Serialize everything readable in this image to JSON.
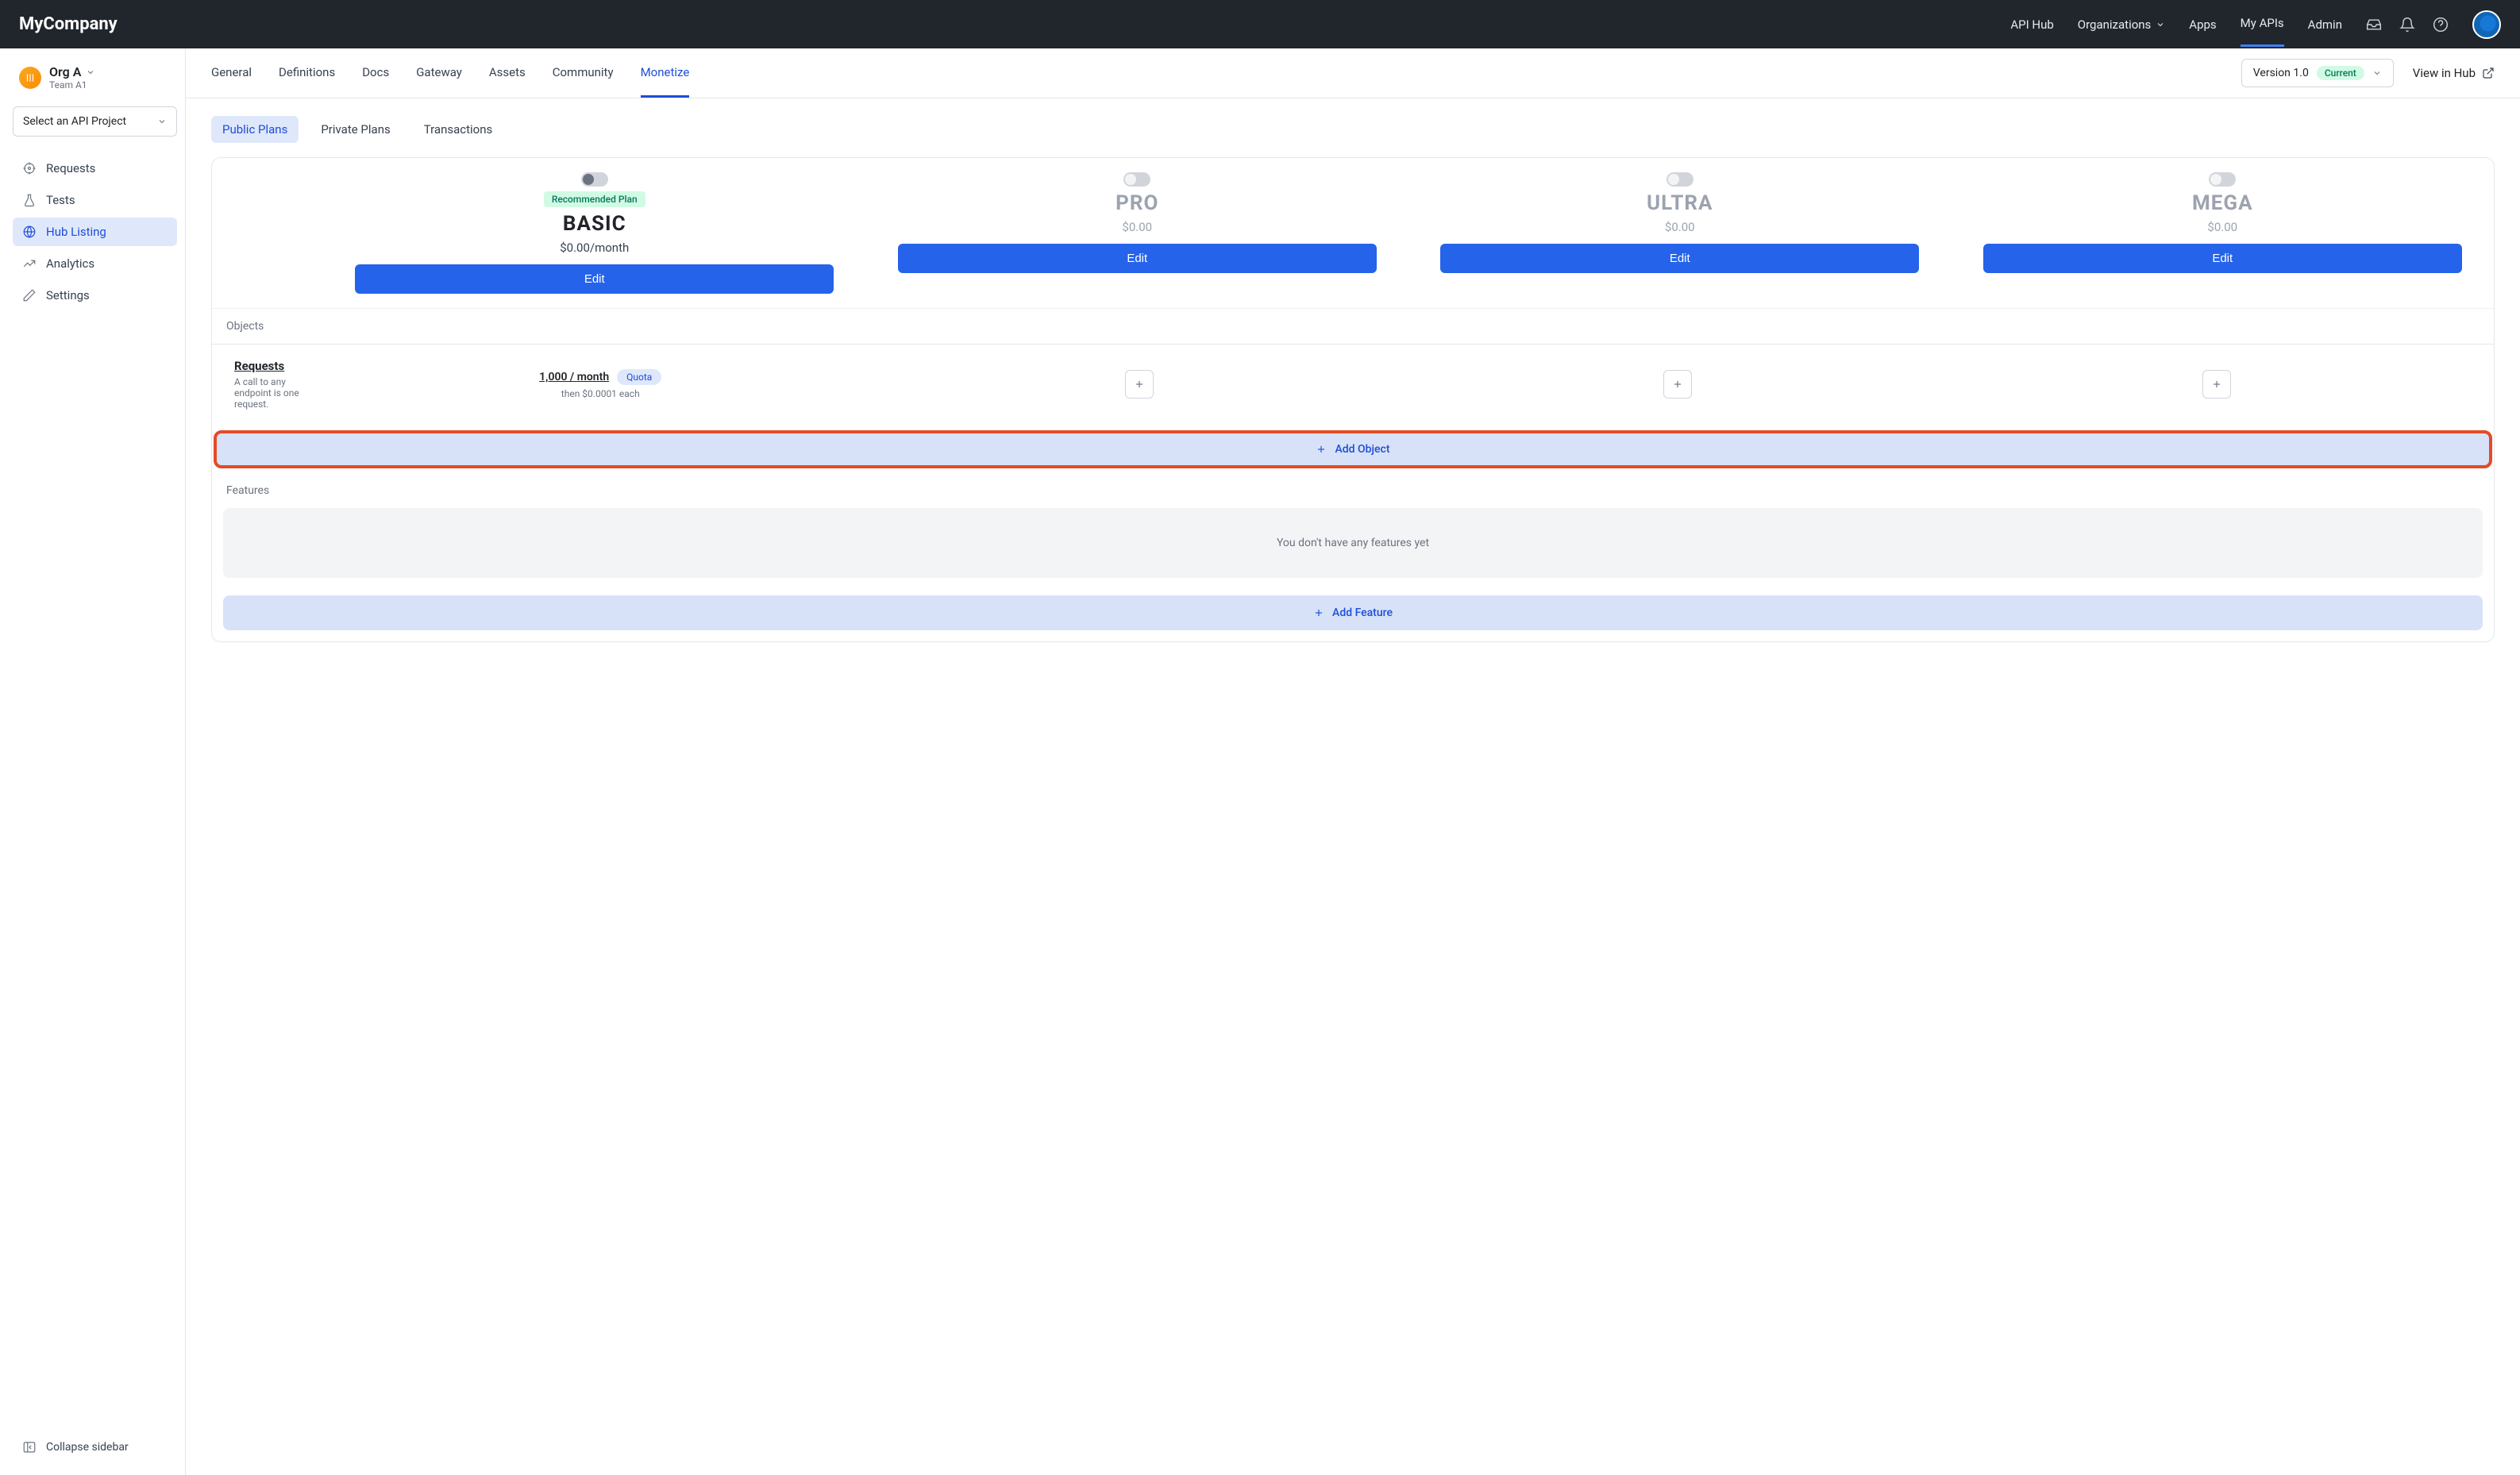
{
  "header": {
    "brand": "MyCompany",
    "nav": {
      "api_hub": "API Hub",
      "organizations": "Organizations",
      "apps": "Apps",
      "my_apis": "My APIs",
      "admin": "Admin"
    }
  },
  "sidebar": {
    "org_name": "Org A",
    "team_name": "Team A1",
    "project_select_label": "Select an API Project",
    "items": {
      "requests": "Requests",
      "tests": "Tests",
      "hub_listing": "Hub Listing",
      "analytics": "Analytics",
      "settings": "Settings"
    },
    "collapse_label": "Collapse sidebar"
  },
  "subheader": {
    "tabs": {
      "general": "General",
      "definitions": "Definitions",
      "docs": "Docs",
      "gateway": "Gateway",
      "assets": "Assets",
      "community": "Community",
      "monetize": "Monetize"
    },
    "version_label": "Version 1.0",
    "current_badge": "Current",
    "view_in_hub": "View in Hub"
  },
  "plan_tabs": {
    "public": "Public Plans",
    "private": "Private Plans",
    "transactions": "Transactions"
  },
  "plans": [
    {
      "name": "BASIC",
      "price": "$0.00/month",
      "recommended": "Recommended Plan",
      "active": true,
      "edit": "Edit"
    },
    {
      "name": "PRO",
      "price": "$0.00",
      "active": false,
      "edit": "Edit"
    },
    {
      "name": "ULTRA",
      "price": "$0.00",
      "active": false,
      "edit": "Edit"
    },
    {
      "name": "MEGA",
      "price": "$0.00",
      "active": false,
      "edit": "Edit"
    }
  ],
  "sections": {
    "objects": "Objects",
    "features": "Features"
  },
  "object_row": {
    "name": "Requests",
    "desc": "A call to any endpoint is one request.",
    "quota_value": "1,000 / month",
    "quota_badge": "Quota",
    "quota_sub": "then $0.0001 each"
  },
  "add_object_label": "Add Object",
  "features_empty": "You don't have any features yet",
  "add_feature_label": "Add Feature"
}
